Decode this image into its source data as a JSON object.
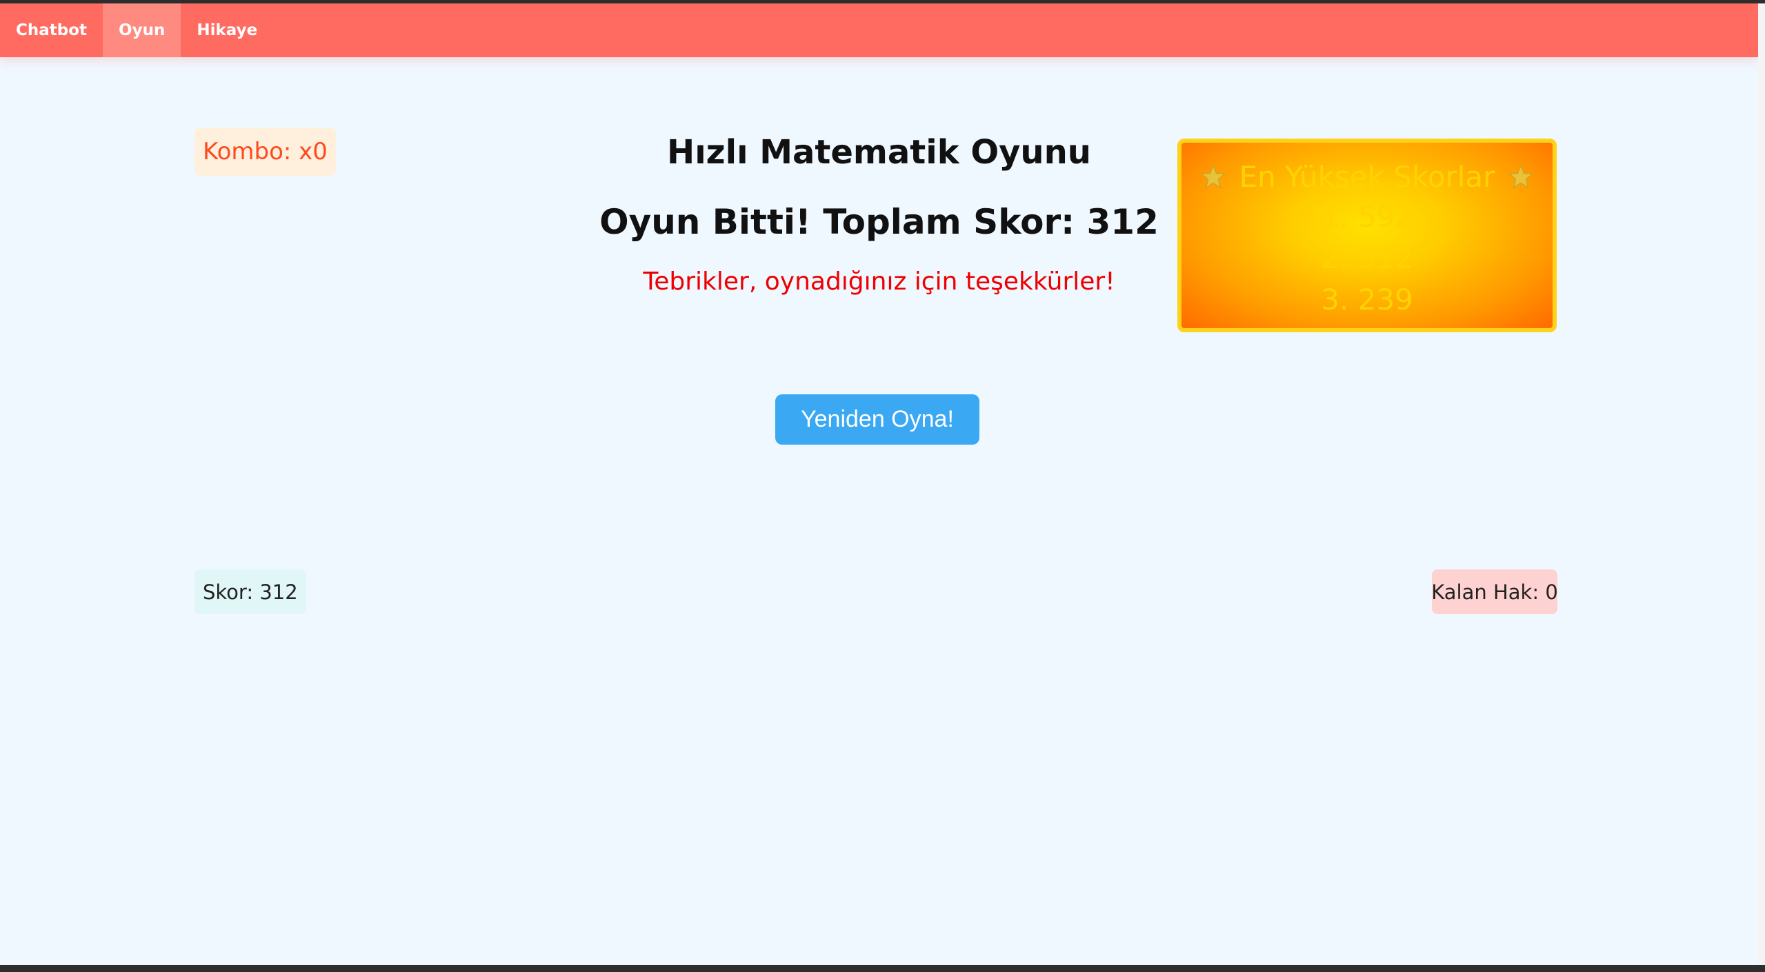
{
  "nav": {
    "items": [
      {
        "label": "Chatbot",
        "active": false
      },
      {
        "label": "Oyun",
        "active": true
      },
      {
        "label": "Hikaye",
        "active": false
      }
    ]
  },
  "game": {
    "combo": "Kombo: x0",
    "title": "Hızlı Matematik Oyunu",
    "final_score": "Oyun Bitti! Toplam Skor: 312",
    "congrats": "Tebrikler, oynadığınız için teşekkürler!",
    "replay_label": "Yeniden Oyna!",
    "score": "Skor: 312",
    "lives": "Kalan Hak: 0"
  },
  "leaderboard": {
    "title": "En Yüksek Skorlar",
    "icon": "star-icon",
    "entries": [
      "1. 592",
      "2. 312",
      "3. 239"
    ]
  },
  "colors": {
    "nav_bg": "#ff6b61",
    "nav_active": "#ff8a80",
    "page_bg": "#eff8ff",
    "combo_text": "#ff4a1f",
    "congrats_text": "#ee0000",
    "button_bg": "#3aa8f2",
    "leaderboard_border": "#ffd21a",
    "leaderboard_text": "#ffd200"
  }
}
